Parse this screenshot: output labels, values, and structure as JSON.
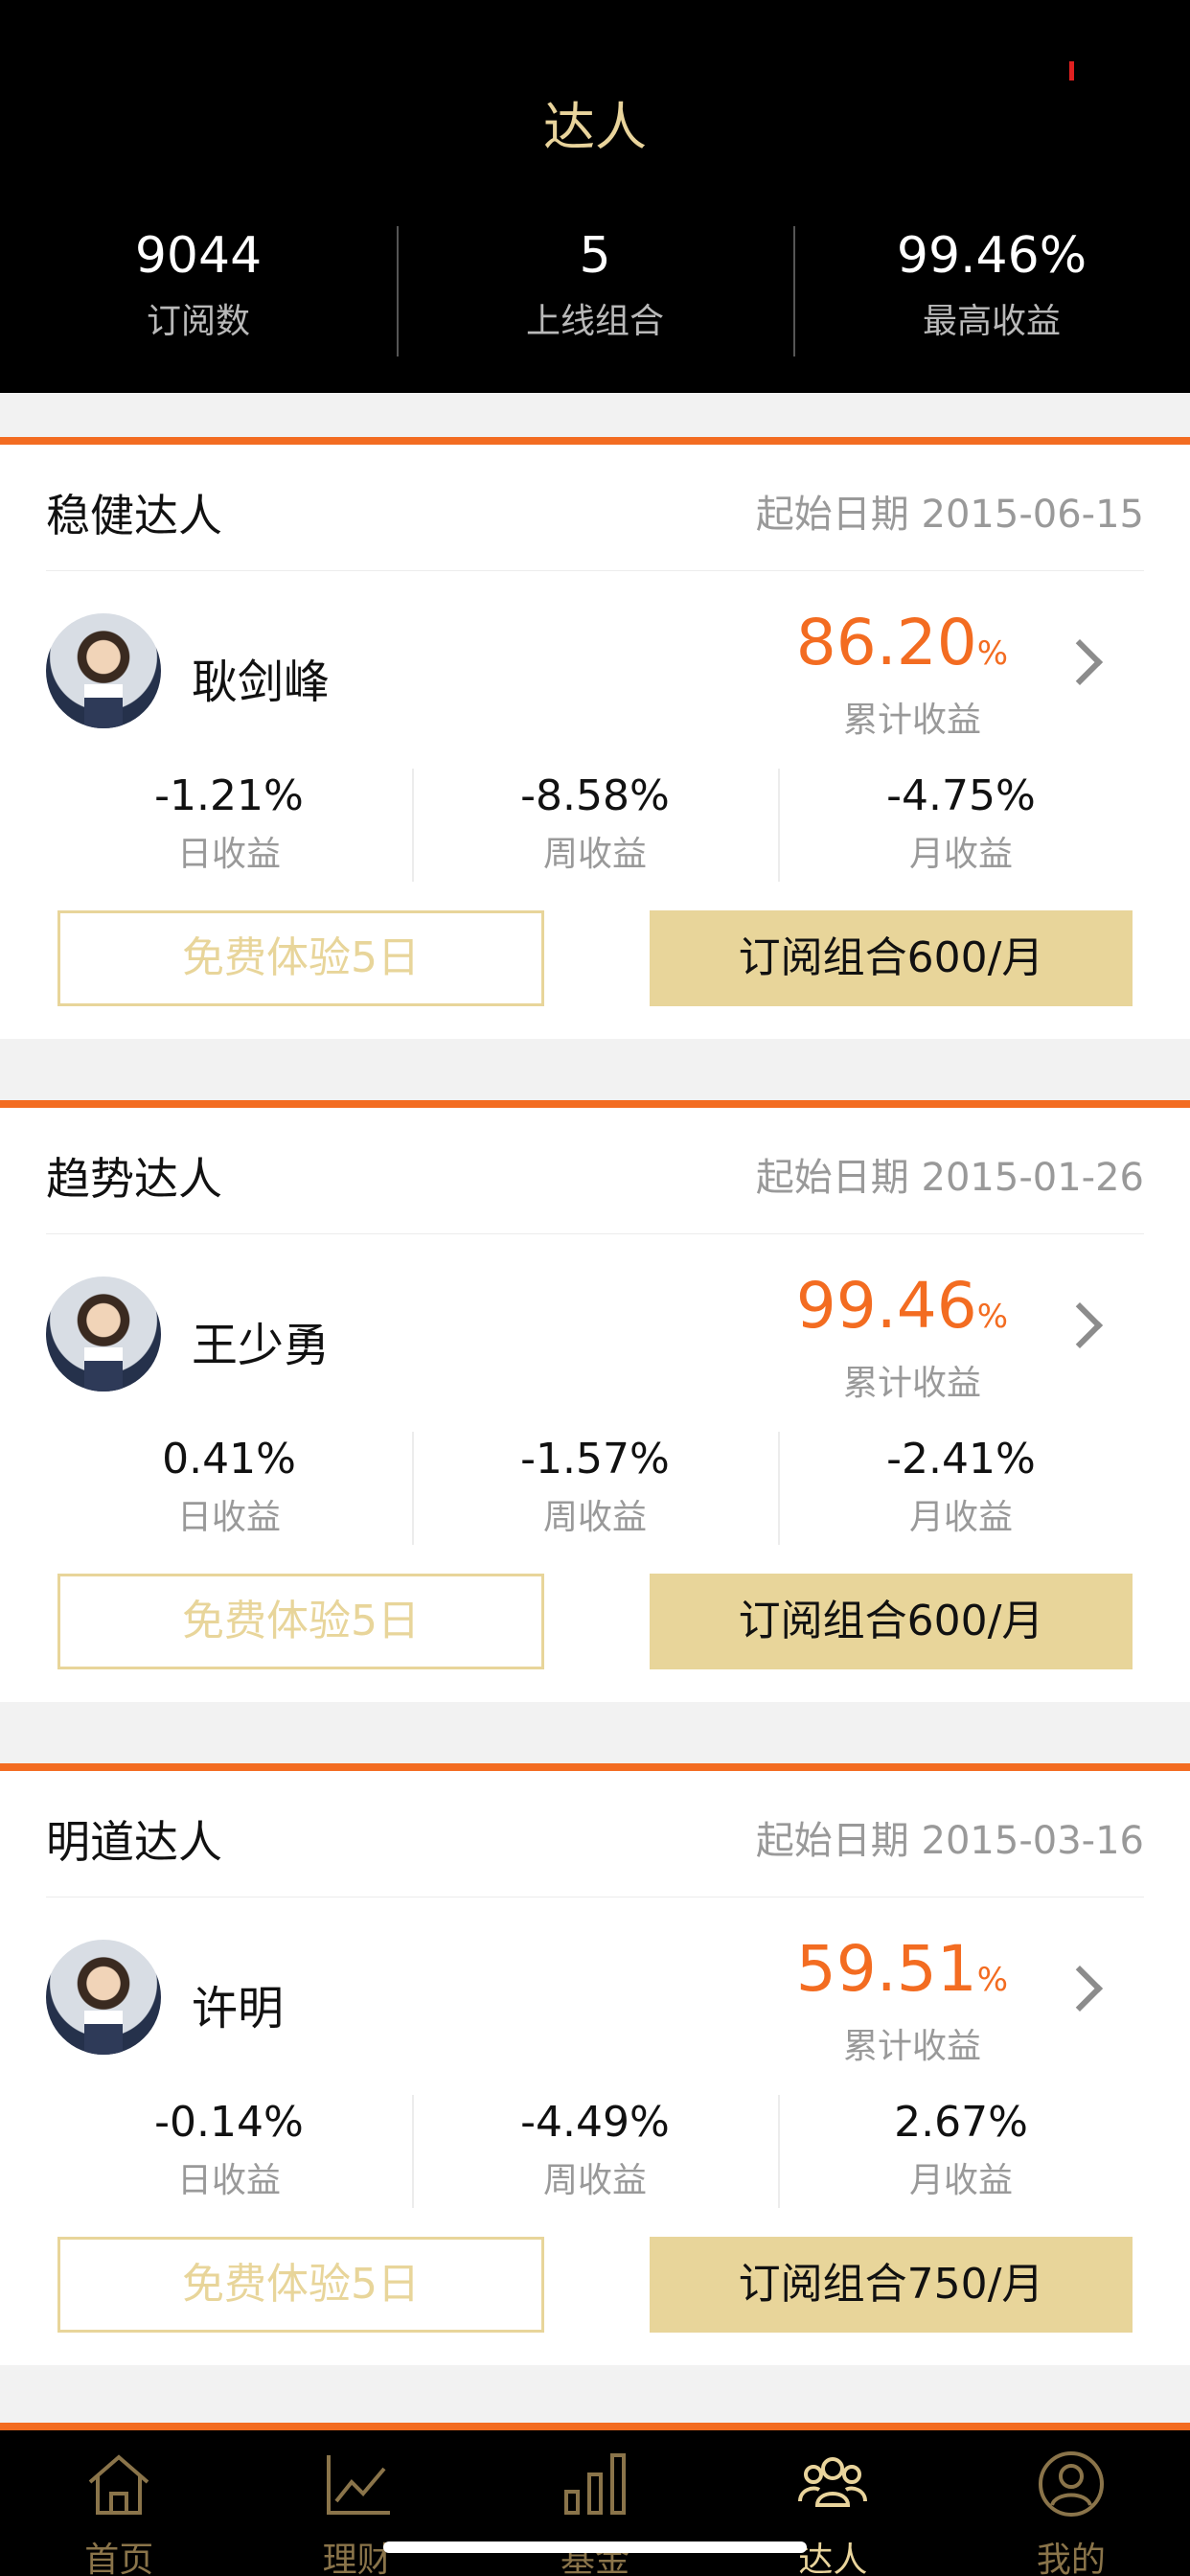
{
  "header": {
    "title": "达人",
    "stats": [
      {
        "value": "9044",
        "label": "订阅数"
      },
      {
        "value": "5",
        "label": "上线组合"
      },
      {
        "value": "99.46%",
        "label": "最高收益"
      }
    ]
  },
  "cards": [
    {
      "title": "稳健达人",
      "date": "起始日期 2015-06-15",
      "name": "耿剑峰",
      "total_return": "86.20",
      "total_return_unit": "%",
      "total_return_label": "累计收益",
      "stats": [
        {
          "value": "-1.21%",
          "label": "日收益"
        },
        {
          "value": "-8.58%",
          "label": "周收益"
        },
        {
          "value": "-4.75%",
          "label": "月收益"
        }
      ],
      "trial_label": "免费体验5日",
      "subscribe_label": "订阅组合600/月"
    },
    {
      "title": "趋势达人",
      "date": "起始日期 2015-01-26",
      "name": "王少勇",
      "total_return": "99.46",
      "total_return_unit": "%",
      "total_return_label": "累计收益",
      "stats": [
        {
          "value": "0.41%",
          "label": "日收益"
        },
        {
          "value": "-1.57%",
          "label": "周收益"
        },
        {
          "value": "-2.41%",
          "label": "月收益"
        }
      ],
      "trial_label": "免费体验5日",
      "subscribe_label": "订阅组合600/月"
    },
    {
      "title": "明道达人",
      "date": "起始日期 2015-03-16",
      "name": "许明",
      "total_return": "59.51",
      "total_return_unit": "%",
      "total_return_label": "累计收益",
      "stats": [
        {
          "value": "-0.14%",
          "label": "日收益"
        },
        {
          "value": "-4.49%",
          "label": "周收益"
        },
        {
          "value": "2.67%",
          "label": "月收益"
        }
      ],
      "trial_label": "免费体验5日",
      "subscribe_label": "订阅组合750/月"
    }
  ],
  "tabbar": {
    "items": [
      {
        "label": "首页",
        "icon": "home-icon"
      },
      {
        "label": "理财",
        "icon": "line-chart-icon"
      },
      {
        "label": "基金",
        "icon": "bar-chart-icon"
      },
      {
        "label": "达人",
        "icon": "people-icon",
        "active": true
      },
      {
        "label": "我的",
        "icon": "profile-icon"
      }
    ]
  },
  "colors": {
    "accent": "#f36c21",
    "gold": "#e8d59a",
    "header_bg": "#000000"
  }
}
